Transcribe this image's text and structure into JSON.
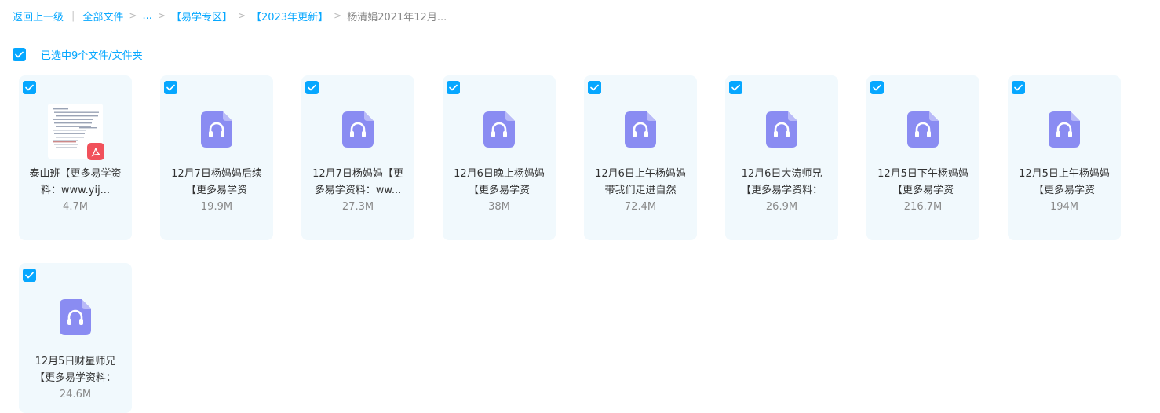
{
  "breadcrumb": {
    "back": "返回上一级",
    "all_files": "全部文件",
    "ellipsis": "...",
    "folder1": "【易学专区】",
    "folder2": "【2023年更新】",
    "current": "杨清娟2021年12月..."
  },
  "selection": {
    "label": "已选中9个文件/文件夹",
    "checked": true
  },
  "colors": {
    "accent": "#06a7ff",
    "card_bg": "#f1f9fd",
    "audio_icon": "#8a8cf2",
    "pdf_badge": "#f1515b"
  },
  "files": [
    {
      "type": "pdf",
      "icon": "pdf-icon",
      "name": "泰山班【更多易学资料：www.yij...",
      "size": "4.7M",
      "checked": true
    },
    {
      "type": "audio",
      "icon": "audio-icon",
      "name": "12月7日杨妈妈后续【更多易学资",
      "size": "19.9M",
      "checked": true
    },
    {
      "type": "audio",
      "icon": "audio-icon",
      "name": "12月7日杨妈妈【更多易学资料：ww...",
      "size": "27.3M",
      "checked": true
    },
    {
      "type": "audio",
      "icon": "audio-icon",
      "name": "12月6日晚上杨妈妈【更多易学资",
      "size": "38M",
      "checked": true
    },
    {
      "type": "audio",
      "icon": "audio-icon",
      "name": "12月6日上午杨妈妈带我们走进自然",
      "size": "72.4M",
      "checked": true
    },
    {
      "type": "audio",
      "icon": "audio-icon",
      "name": "12月6日大涛师兄【更多易学资料：",
      "size": "26.9M",
      "checked": true
    },
    {
      "type": "audio",
      "icon": "audio-icon",
      "name": "12月5日下午杨妈妈【更多易学资",
      "size": "216.7M",
      "checked": true
    },
    {
      "type": "audio",
      "icon": "audio-icon",
      "name": "12月5日上午杨妈妈【更多易学资",
      "size": "194M",
      "checked": true
    },
    {
      "type": "audio",
      "icon": "audio-icon",
      "name": "12月5日财星师兄【更多易学资料：",
      "size": "24.6M",
      "checked": true
    }
  ]
}
